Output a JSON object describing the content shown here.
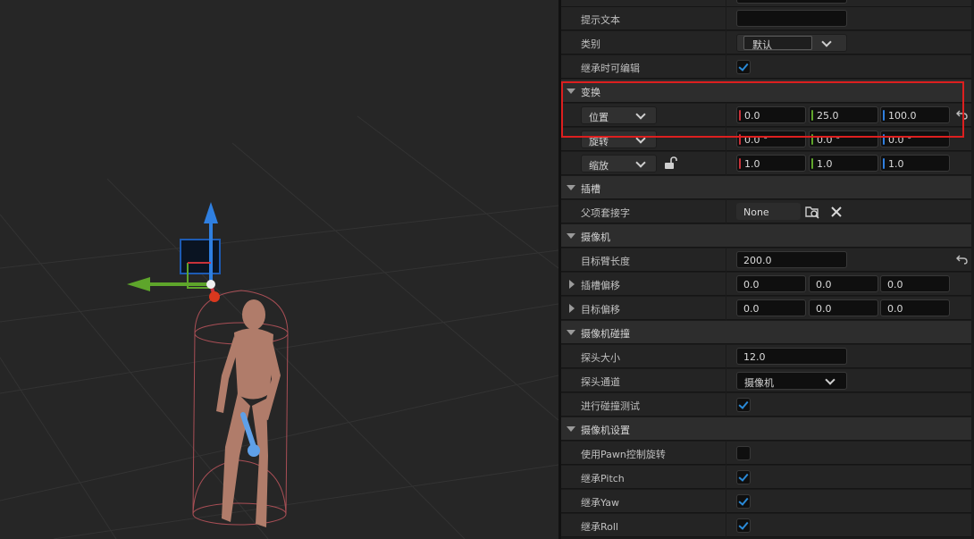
{
  "colors": {
    "x_axis": "#c8323a",
    "y_axis": "#5ea52b",
    "z_axis": "#2f7fe0",
    "checkbox": "#2a8ad8",
    "highlight": "#dd1f1f"
  },
  "viewport": {
    "gizmo_icons": [
      "translate-gizmo-x-arrow",
      "translate-gizmo-y-arrow",
      "translate-gizmo-z-arrow",
      "camera-component-icon"
    ]
  },
  "details": {
    "tooltip_text": {
      "label": "提示文本",
      "value": ""
    },
    "category": {
      "label": "类别",
      "value": "默认"
    },
    "editable_when_inherited": {
      "label": "继承时可编辑",
      "checked": true
    },
    "transform": {
      "section": "变换",
      "location": {
        "mode": "位置",
        "x": "0.0",
        "y": "25.0",
        "z": "100.0"
      },
      "rotation": {
        "mode": "旋转",
        "x": "0.0 °",
        "y": "0.0 °",
        "z": "0.0 °"
      },
      "scale": {
        "mode": "缩放",
        "x": "1.0",
        "y": "1.0",
        "z": "1.0",
        "lock_icon": "unlock-icon"
      }
    },
    "sockets": {
      "section": "插槽",
      "parent_socket": {
        "label": "父项套接字",
        "value": "None"
      }
    },
    "camera": {
      "section": "摄像机",
      "target_arm_length": {
        "label": "目标臂长度",
        "value": "200.0"
      },
      "socket_offset": {
        "label": "插槽偏移",
        "x": "0.0",
        "y": "0.0",
        "z": "0.0"
      },
      "target_offset": {
        "label": "目标偏移",
        "x": "0.0",
        "y": "0.0",
        "z": "0.0"
      }
    },
    "camera_collision": {
      "section": "摄像机碰撞",
      "probe_size": {
        "label": "探头大小",
        "value": "12.0"
      },
      "probe_channel": {
        "label": "探头通道",
        "value": "摄像机"
      },
      "do_collision_test": {
        "label": "进行碰撞测试",
        "checked": true
      }
    },
    "camera_settings": {
      "section": "摄像机设置",
      "use_pawn_control_rotation": {
        "label": "使用Pawn控制旋转",
        "checked": false
      },
      "inherit_pitch": {
        "label": "继承Pitch",
        "checked": true
      },
      "inherit_yaw": {
        "label": "继承Yaw",
        "checked": true
      },
      "inherit_roll": {
        "label": "继承Roll",
        "checked": true
      }
    }
  }
}
